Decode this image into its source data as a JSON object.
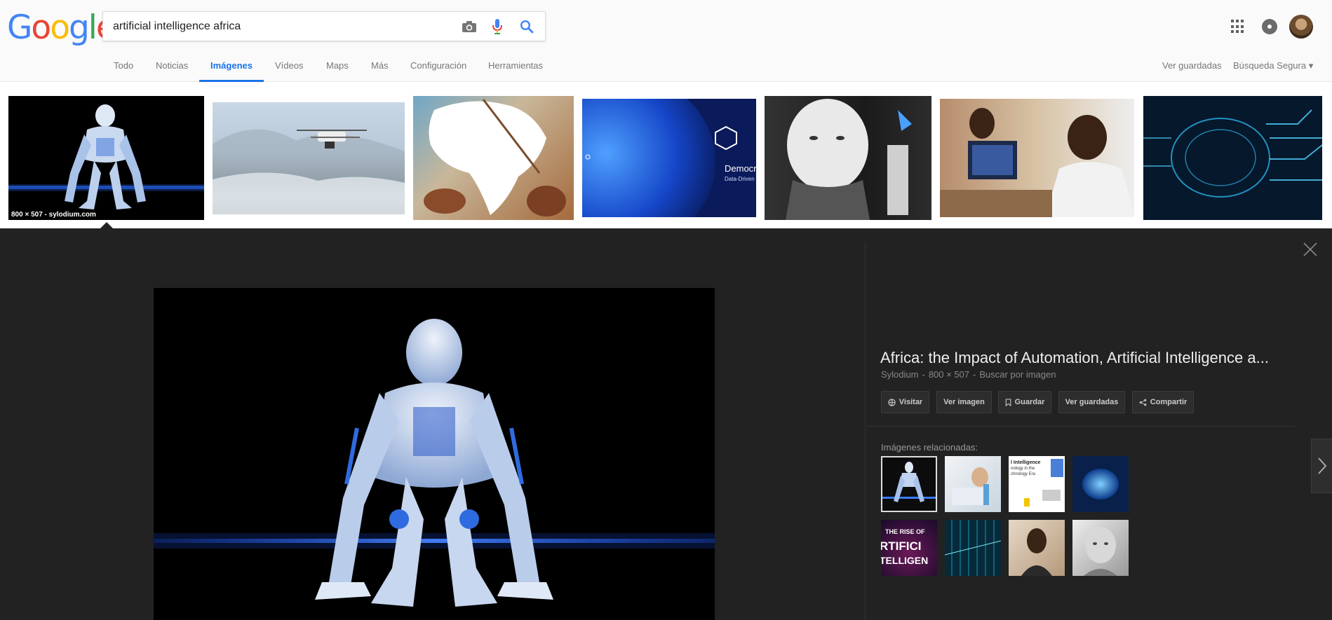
{
  "logo": {
    "letters": [
      "G",
      "o",
      "o",
      "g",
      "l",
      "e"
    ],
    "colors": [
      "#4285F4",
      "#EA4335",
      "#FBBC05",
      "#4285F4",
      "#34A853",
      "#EA4335"
    ]
  },
  "search": {
    "value": "artificial intelligence africa"
  },
  "nav": {
    "items": [
      "Todo",
      "Noticias",
      "Imágenes",
      "Vídeos",
      "Maps",
      "Más",
      "Configuración",
      "Herramientas"
    ],
    "active": "Imágenes",
    "right": [
      "Ver guardadas",
      "Búsqueda Segura ▾"
    ]
  },
  "thumbs": {
    "first_caption": "800 × 507 - sylodium.com",
    "overlay_text": "Democr",
    "overlay_sub": "Data-Driven"
  },
  "detail": {
    "title": "Africa: the Impact of Automation, Artificial Intelligence a...",
    "source": "Sylodium",
    "size": "800 × 507",
    "search_by_image": "Buscar por imagen",
    "actions": [
      "Visitar",
      "Ver imagen",
      "Guardar",
      "Ver guardadas",
      "Compartir"
    ],
    "related_label": "Imágenes relacionadas:",
    "related_texts": {
      "thumb3_line1": "l Intelligence",
      "thumb3_line2": "nology in the",
      "thumb3_line3": "chnology Era",
      "thumb5_line1": "THE RISE OF",
      "thumb5_line2": "RTIFICI",
      "thumb5_line3": "TELLIGEN"
    }
  },
  "colors": {
    "accent": "#1a73e8",
    "panel": "#222222"
  }
}
